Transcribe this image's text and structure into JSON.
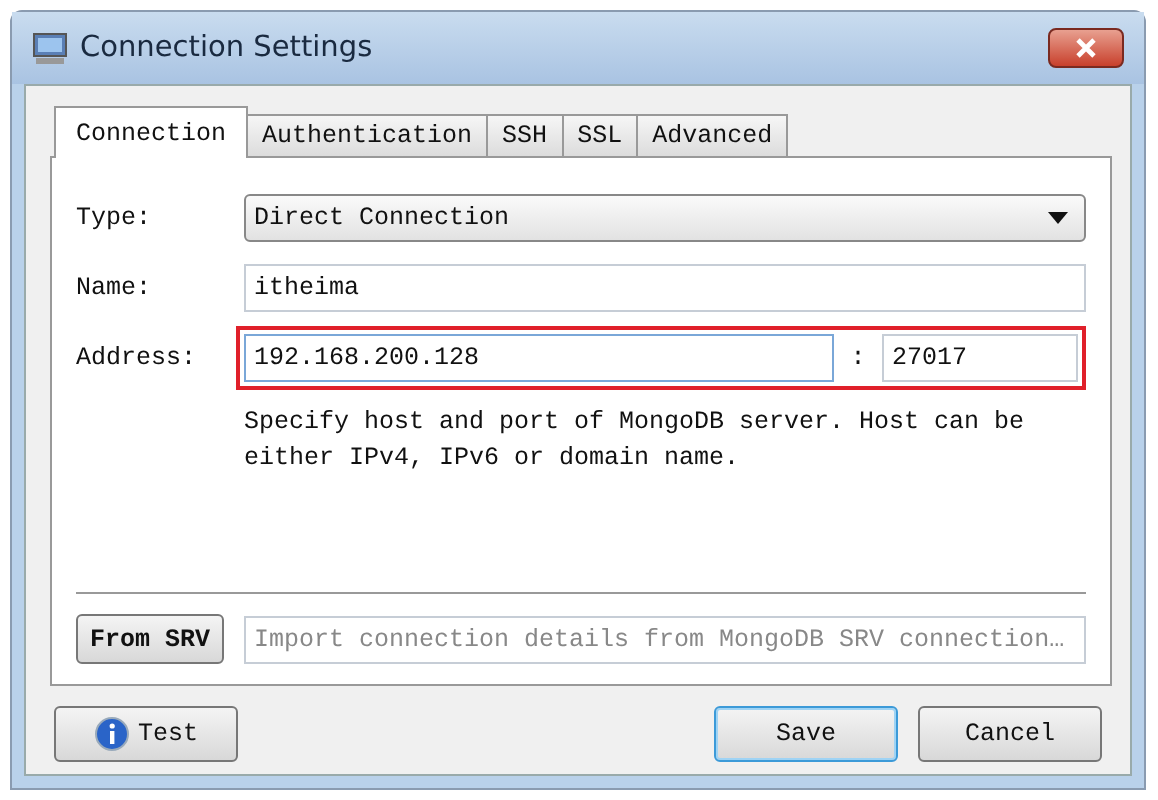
{
  "window": {
    "title": "Connection Settings"
  },
  "tabs": [
    {
      "label": "Connection",
      "selected": true
    },
    {
      "label": "Authentication",
      "selected": false
    },
    {
      "label": "SSH",
      "selected": false
    },
    {
      "label": "SSL",
      "selected": false
    },
    {
      "label": "Advanced",
      "selected": false
    }
  ],
  "type": {
    "label": "Type:",
    "value": "Direct Connection"
  },
  "name": {
    "label": "Name:",
    "value": "itheima"
  },
  "address": {
    "label": "Address:",
    "host": "192.168.200.128",
    "separator": ":",
    "port": "27017",
    "highlighted": true
  },
  "help_text": "Specify host and port of MongoDB server. Host can be either IPv4, IPv6 or domain name.",
  "srv": {
    "button": "From SRV",
    "placeholder": "Import connection details from MongoDB SRV connection…"
  },
  "buttons": [
    {
      "kind": "test",
      "label": "Test",
      "default": false
    },
    {
      "kind": "save",
      "label": "Save",
      "default": true
    },
    {
      "kind": "cancel",
      "label": "Cancel",
      "default": false
    }
  ]
}
